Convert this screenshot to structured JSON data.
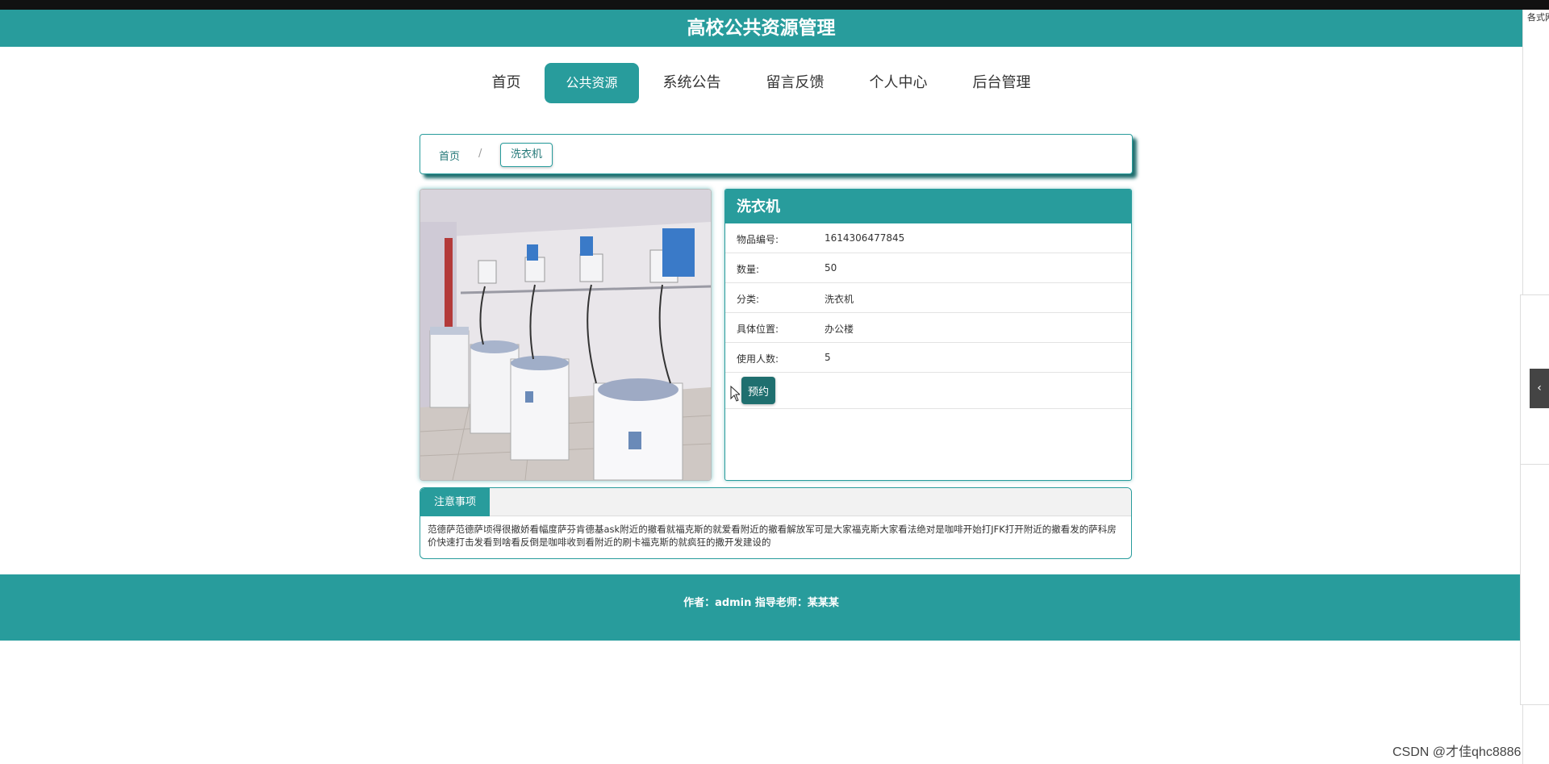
{
  "app": {
    "title": "高校公共资源管理"
  },
  "corner_text": "各式网",
  "nav": {
    "items": [
      {
        "label": "首页"
      },
      {
        "label": "公共资源",
        "active": true
      },
      {
        "label": "系统公告"
      },
      {
        "label": "留言反馈"
      },
      {
        "label": "个人中心"
      },
      {
        "label": "后台管理"
      }
    ]
  },
  "breadcrumb": {
    "home": "首页",
    "separator": "/",
    "current": "洗衣机"
  },
  "item": {
    "name": "洗衣机",
    "fields": [
      {
        "label": "物品编号:",
        "value": "1614306477845"
      },
      {
        "label": "数量:",
        "value": "50"
      },
      {
        "label": "分类:",
        "value": "洗衣机"
      },
      {
        "label": "具体位置:",
        "value": "办公楼"
      },
      {
        "label": "使用人数:",
        "value": "5"
      }
    ],
    "reserve_label": "预约"
  },
  "notes": {
    "tab_label": "注意事项",
    "text": "范德萨范德萨顷得很撤娇看幅度萨芬肯德基ask附近的撤看就福克斯的就爱看附近的撤看解放军可是大家福克斯大家看法绝对是咖啡开始打JFK打开附近的撤看发的萨科房价快速打击发看到啥看反倒是咖啡收到看附近的刷卡福克斯的就疯狂的撒开发建设的"
  },
  "footer": {
    "text": "作者：admin 指导老师：某某某"
  },
  "watermark": "CSDN @才佳qhc8886",
  "colors": {
    "primary": "#289c9c",
    "dark": "#1f6f6f"
  },
  "icons": {
    "side_toggle": "chevron-left-icon"
  }
}
